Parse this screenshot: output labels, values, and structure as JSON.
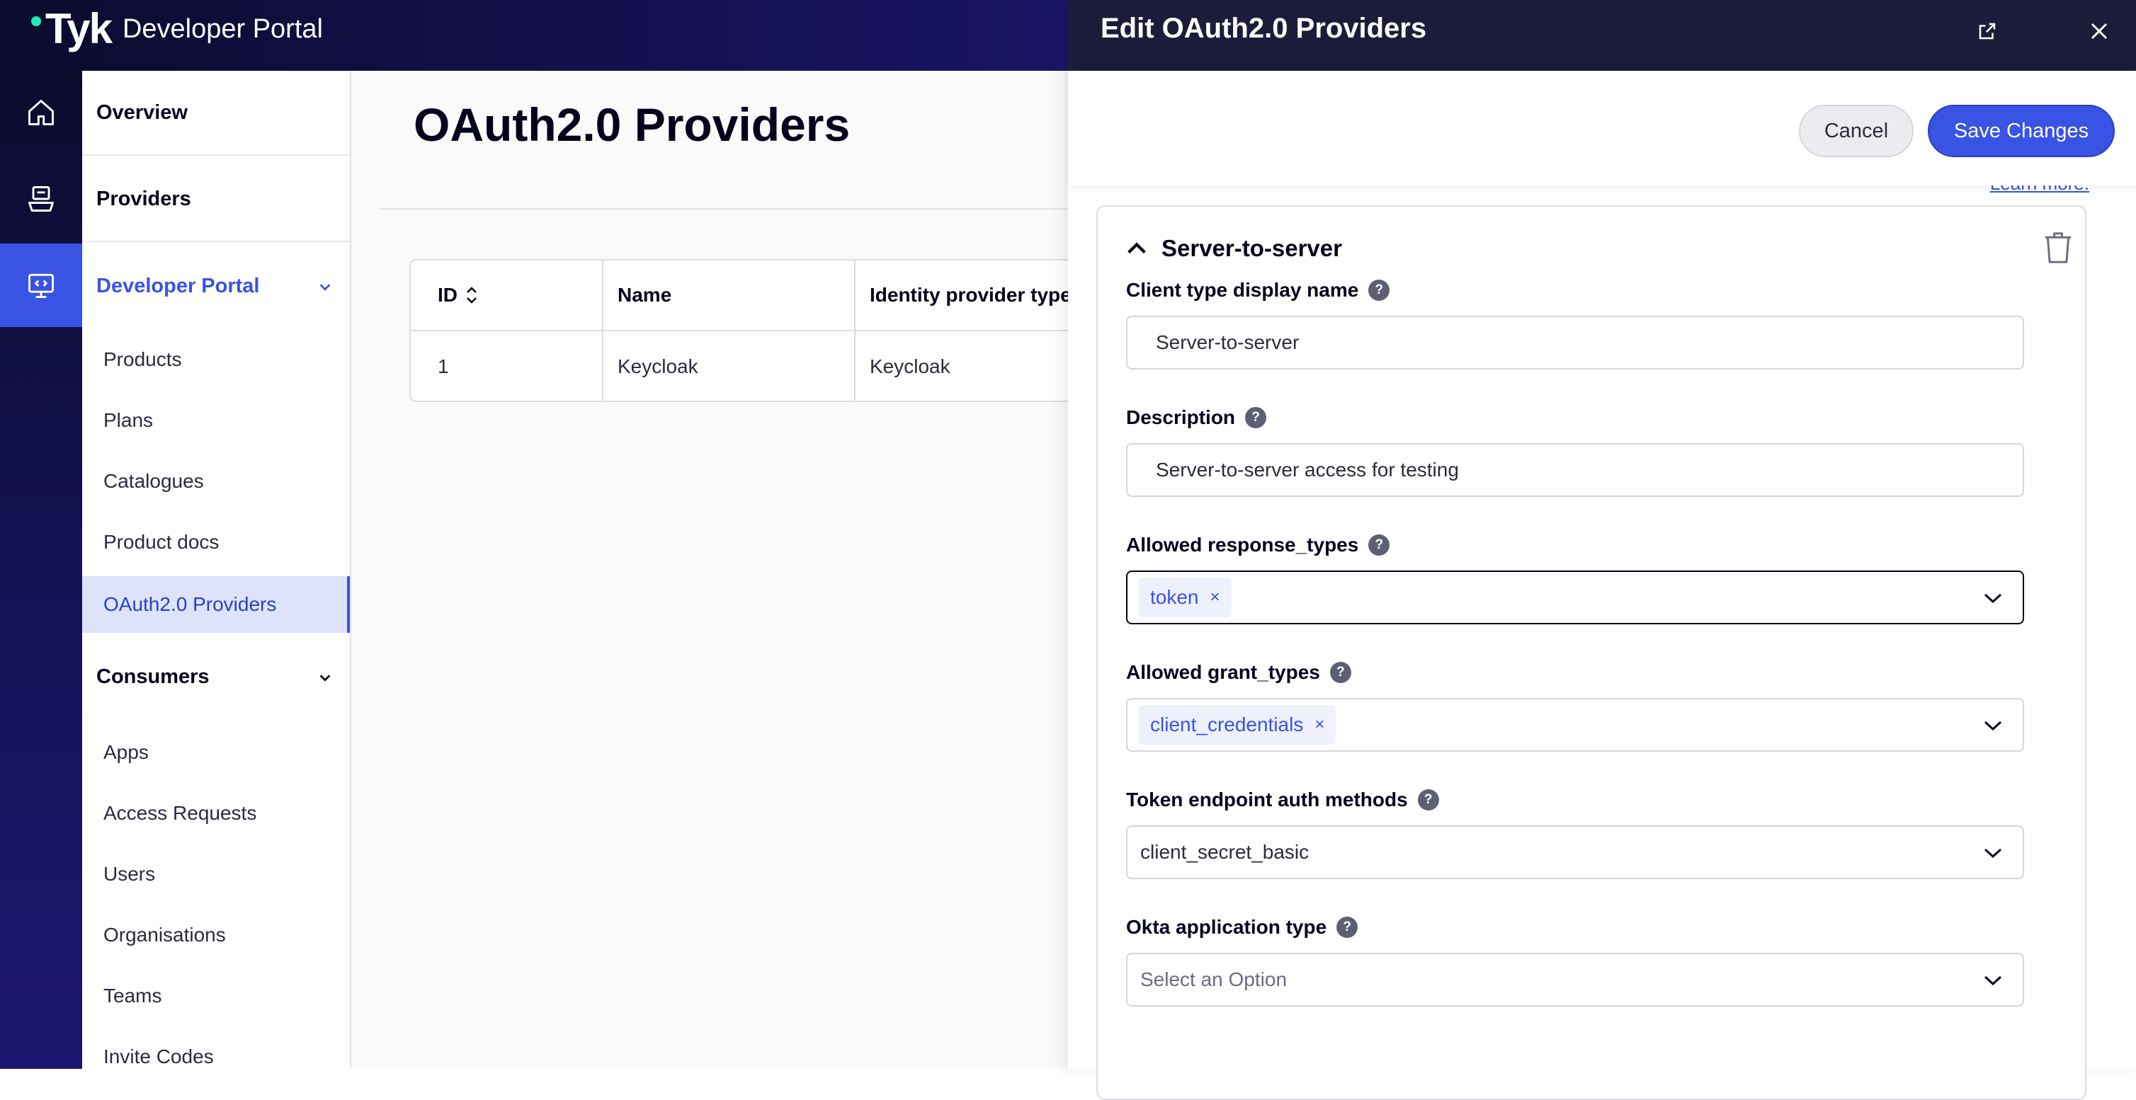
{
  "app": {
    "logo_text": "Tyk",
    "name": "Developer Portal"
  },
  "rail": {
    "icons": [
      "home-icon",
      "api-box-icon",
      "developer-portal-icon"
    ]
  },
  "sidebar": {
    "overview": "Overview",
    "providers": "Providers",
    "developer_portal": "Developer Portal",
    "portal_items": [
      "Products",
      "Plans",
      "Catalogues",
      "Product docs",
      "OAuth2.0 Providers"
    ],
    "consumers": "Consumers",
    "consumer_items": [
      "Apps",
      "Access Requests",
      "Users",
      "Organisations",
      "Teams",
      "Invite Codes"
    ]
  },
  "main": {
    "title": "OAuth2.0 Providers",
    "table": {
      "headers": [
        "ID",
        "Name",
        "Identity provider type"
      ],
      "rows": [
        [
          "1",
          "Keycloak",
          "Keycloak"
        ]
      ]
    }
  },
  "drawer": {
    "title": "Edit OAuth2.0 Providers",
    "cancel": "Cancel",
    "save": "Save Changes",
    "learn_more": "Learn more.",
    "section": {
      "title": "Server-to-server",
      "client_type_label": "Client type display name",
      "client_type_value": "Server-to-server",
      "description_label": "Description",
      "description_value": "Server-to-server access for testing",
      "response_types_label": "Allowed response_types",
      "response_types": [
        "token"
      ],
      "grant_types_label": "Allowed grant_types",
      "grant_types": [
        "client_credentials"
      ],
      "token_auth_label": "Token endpoint auth methods",
      "token_auth_value": "client_secret_basic",
      "okta_label": "Okta application type",
      "okta_placeholder": "Select an Option"
    }
  },
  "colors": {
    "accent": "#3953e4",
    "header": "#1c1c3a",
    "active_nav_bg": "#dde3fb"
  }
}
